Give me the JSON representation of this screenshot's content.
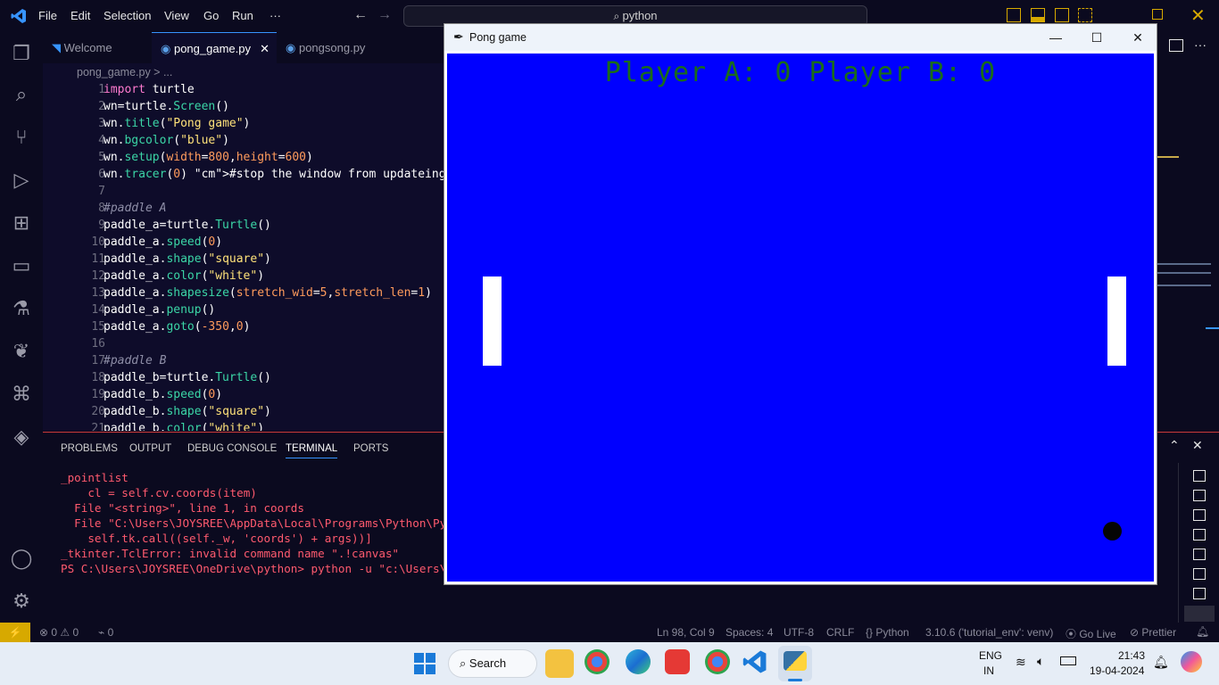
{
  "titlebar": {
    "menus": [
      "File",
      "Edit",
      "Selection",
      "View",
      "Go",
      "Run",
      "···"
    ],
    "search_text": "python"
  },
  "tabs": [
    {
      "label": "Welcome"
    },
    {
      "label": "pong_game.py"
    },
    {
      "label": "pongsong.py"
    }
  ],
  "breadcrumb": "pong_game.py > ...",
  "editor_lines": [
    {
      "n": "1",
      "t": "import turtle"
    },
    {
      "n": "2",
      "t": "wn=turtle.Screen()"
    },
    {
      "n": "3",
      "t": "wn.title(\"Pong game\")"
    },
    {
      "n": "4",
      "t": "wn.bgcolor(\"blue\")"
    },
    {
      "n": "5",
      "t": "wn.setup(width=800,height=600)"
    },
    {
      "n": "6",
      "t": "wn.tracer(0) #stop the window from updateing"
    },
    {
      "n": "7",
      "t": ""
    },
    {
      "n": "8",
      "t": "#paddle A"
    },
    {
      "n": "9",
      "t": "paddle_a=turtle.Turtle()"
    },
    {
      "n": "10",
      "t": "paddle_a.speed(0)"
    },
    {
      "n": "11",
      "t": "paddle_a.shape(\"square\")"
    },
    {
      "n": "12",
      "t": "paddle_a.color(\"white\")"
    },
    {
      "n": "13",
      "t": "paddle_a.shapesize(stretch_wid=5,stretch_len=1)"
    },
    {
      "n": "14",
      "t": "paddle_a.penup()"
    },
    {
      "n": "15",
      "t": "paddle_a.goto(-350,0)"
    },
    {
      "n": "16",
      "t": ""
    },
    {
      "n": "17",
      "t": "#paddle B"
    },
    {
      "n": "18",
      "t": "paddle_b=turtle.Turtle()"
    },
    {
      "n": "19",
      "t": "paddle_b.speed(0)"
    },
    {
      "n": "20",
      "t": "paddle_b.shape(\"square\")"
    },
    {
      "n": "21",
      "t": "paddle_b.color(\"white\")"
    }
  ],
  "panel": {
    "tabs": [
      "PROBLEMS",
      "OUTPUT",
      "DEBUG CONSOLE",
      "TERMINAL",
      "PORTS"
    ],
    "terminal_lines": [
      "_pointlist",
      "    cl = self.cv.coords(item)",
      "  File \"<string>\", line 1, in coords",
      "  File \"C:\\Users\\JOYSREE\\AppData\\Local\\Programs\\Python\\Python",
      "    self.tk.call((self._w, 'coords') + args))]",
      "_tkinter.TclError: invalid command name \".!canvas\"",
      "PS C:\\Users\\JOYSREE\\OneDrive\\python> python -u \"c:\\Users\\JOYS"
    ]
  },
  "status": {
    "problems": "0",
    "warnings": "0",
    "ports": "0",
    "position": "Ln 98, Col 9",
    "spaces": "Spaces: 4",
    "encoding": "UTF-8",
    "eol": "CRLF",
    "language": "Python",
    "interpreter": "3.10.6 ('tutorial_env': venv)",
    "golive": "Go Live",
    "prettier": "Prettier"
  },
  "pong": {
    "window_title": "Pong game",
    "score_text": "Player A: 0 Player B: 0",
    "bg_color": "#0000ff"
  },
  "taskbar": {
    "search_label": "Search",
    "lang_top": "ENG",
    "lang_bottom": "IN",
    "time": "21:43",
    "date": "19-04-2024"
  }
}
